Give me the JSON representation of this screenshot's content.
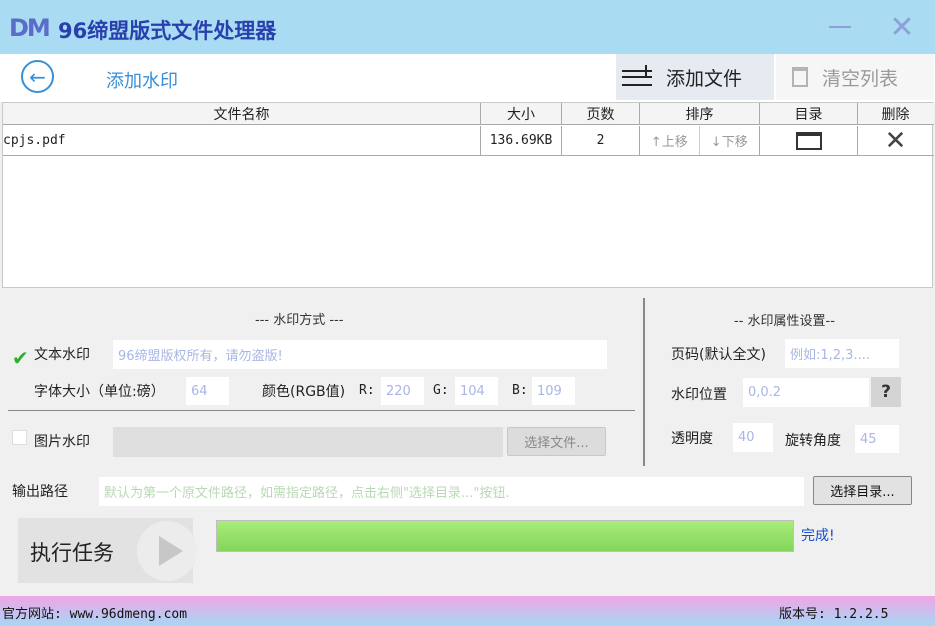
{
  "app": {
    "logo": "DM",
    "title": "96缔盟版式文件处理器"
  },
  "toolbar": {
    "page_title": "添加水印",
    "add_file": "添加文件",
    "clear_list": "清空列表"
  },
  "table": {
    "headers": [
      "文件名称",
      "大小",
      "页数",
      "排序",
      "目录",
      "删除"
    ],
    "rows": [
      {
        "name": "cpjs.pdf",
        "size": "136.69KB",
        "pages": "2",
        "move_up": "↑上移",
        "move_down": "↓下移"
      }
    ]
  },
  "watermark": {
    "section_title": "--- 水印方式 ---",
    "text_label": "文本水印",
    "text_value": "96缔盟版权所有，请勿盗版!",
    "font_size_label": "字体大小（单位:磅）",
    "font_size": "64",
    "color_label": "颜色(RGB值)",
    "r_label": "R:",
    "r": "220",
    "g_label": "G:",
    "g": "104",
    "b_label": "B:",
    "b": "109",
    "image_label": "图片水印",
    "choose_file": "选择文件..."
  },
  "props": {
    "section_title": "-- 水印属性设置--",
    "pages_label": "页码(默认全文)",
    "pages_placeholder": "例如:1,2,3....",
    "position_label": "水印位置",
    "position_value": "0,0.2",
    "help": "?",
    "opacity_label": "透明度",
    "opacity": "40",
    "rotation_label": "旋转角度",
    "rotation": "45"
  },
  "output": {
    "label": "输出路径",
    "placeholder": "默认为第一个原文件路径，如需指定路径，点击右侧\"选择目录...\"按钮.",
    "choose_dir": "选择目录..."
  },
  "run": {
    "label": "执行任务",
    "progress": 1.0,
    "status": "完成!"
  },
  "footer": {
    "site": "官方网站:  www.96dmeng.com",
    "version": "版本号: 1.2.2.5"
  },
  "colors": {
    "titlebar": "#a9dcf3",
    "accent": "#3a8fd6",
    "progress": "#84d55c",
    "done_text": "#1a4fc8"
  }
}
